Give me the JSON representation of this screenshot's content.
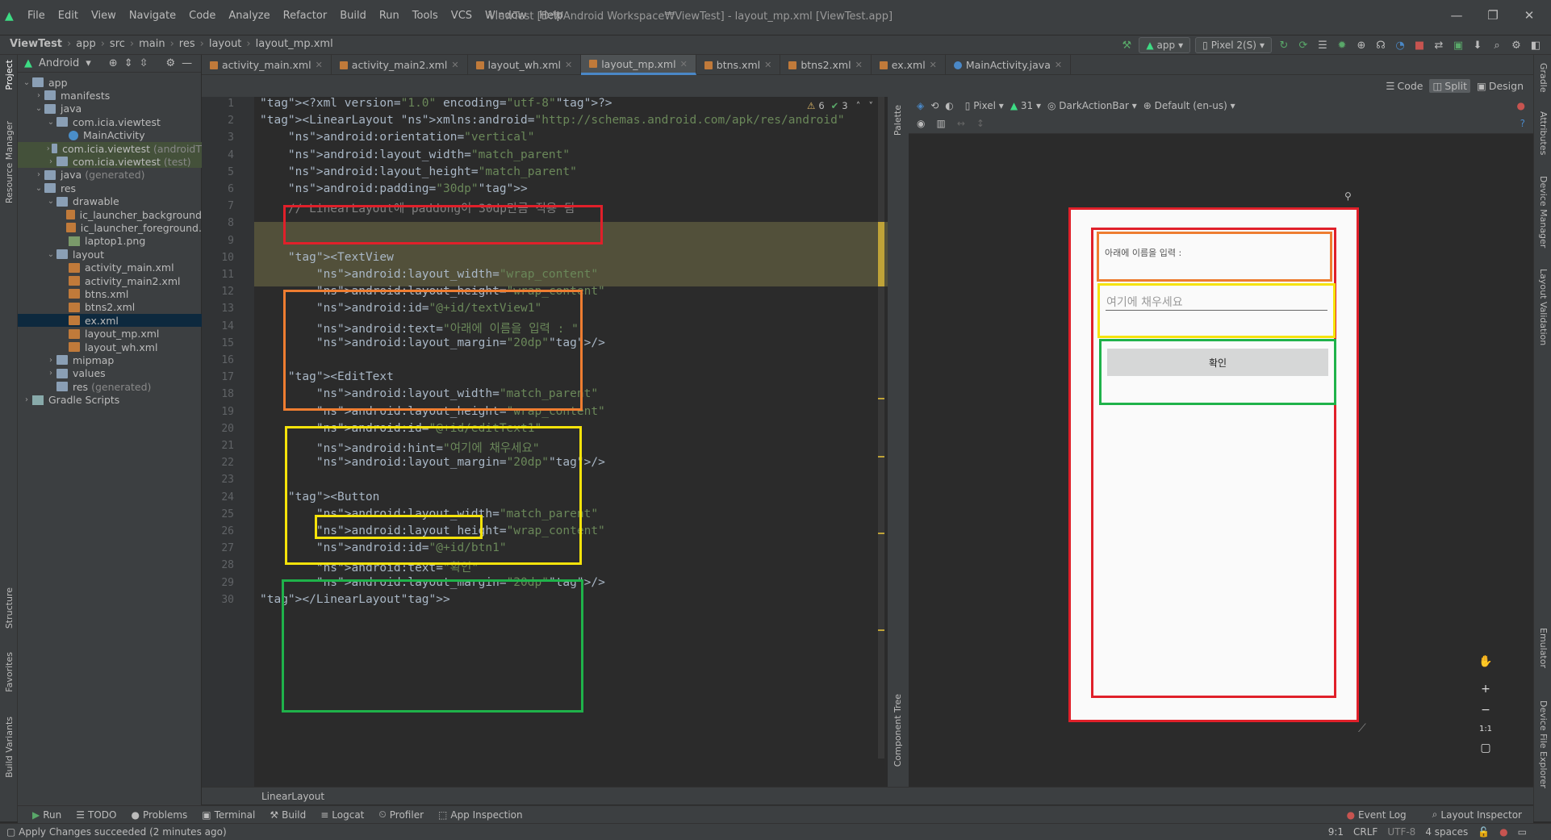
{
  "menubar": {
    "items": [
      "File",
      "Edit",
      "View",
      "Navigate",
      "Code",
      "Analyze",
      "Refactor",
      "Build",
      "Run",
      "Tools",
      "VCS",
      "Window",
      "Help"
    ],
    "window_title": "ViewTest [D:₩Android Workspace₩ViewTest] - layout_mp.xml [ViewTest.app]"
  },
  "breadcrumb": [
    "ViewTest",
    "app",
    "src",
    "main",
    "res",
    "layout",
    "layout_mp.xml"
  ],
  "toolbar": {
    "run_config": "app",
    "device": "Pixel 2(S)"
  },
  "project": {
    "view_label": "Android",
    "tree": [
      {
        "label": "app",
        "indent": 0,
        "kind": "folder",
        "arrow": "v"
      },
      {
        "label": "manifests",
        "indent": 1,
        "kind": "folder",
        "arrow": ">"
      },
      {
        "label": "java",
        "indent": 1,
        "kind": "folder",
        "arrow": "v"
      },
      {
        "label": "com.icia.viewtest",
        "indent": 2,
        "kind": "folder",
        "arrow": "v"
      },
      {
        "label": "MainActivity",
        "indent": 3,
        "kind": "class",
        "arrow": ""
      },
      {
        "label": "com.icia.viewtest",
        "suffix": "(androidT",
        "indent": 2,
        "kind": "folder",
        "arrow": ">",
        "hl": true
      },
      {
        "label": "com.icia.viewtest",
        "suffix": "(test)",
        "indent": 2,
        "kind": "folder",
        "arrow": ">",
        "hl": true
      },
      {
        "label": "java",
        "suffix": "(generated)",
        "indent": 1,
        "kind": "folder",
        "arrow": ">"
      },
      {
        "label": "res",
        "indent": 1,
        "kind": "folder",
        "arrow": "v"
      },
      {
        "label": "drawable",
        "indent": 2,
        "kind": "folder",
        "arrow": "v"
      },
      {
        "label": "ic_launcher_background",
        "indent": 3,
        "kind": "xml",
        "arrow": ""
      },
      {
        "label": "ic_launcher_foreground.",
        "indent": 3,
        "kind": "xml",
        "arrow": ""
      },
      {
        "label": "laptop1.png",
        "indent": 3,
        "kind": "png",
        "arrow": ""
      },
      {
        "label": "layout",
        "indent": 2,
        "kind": "folder",
        "arrow": "v"
      },
      {
        "label": "activity_main.xml",
        "indent": 3,
        "kind": "xml",
        "arrow": ""
      },
      {
        "label": "activity_main2.xml",
        "indent": 3,
        "kind": "xml",
        "arrow": ""
      },
      {
        "label": "btns.xml",
        "indent": 3,
        "kind": "xml",
        "arrow": ""
      },
      {
        "label": "btns2.xml",
        "indent": 3,
        "kind": "xml",
        "arrow": ""
      },
      {
        "label": "ex.xml",
        "indent": 3,
        "kind": "xml",
        "arrow": "",
        "sel": true
      },
      {
        "label": "layout_mp.xml",
        "indent": 3,
        "kind": "xml",
        "arrow": ""
      },
      {
        "label": "layout_wh.xml",
        "indent": 3,
        "kind": "xml",
        "arrow": ""
      },
      {
        "label": "mipmap",
        "indent": 2,
        "kind": "folder",
        "arrow": ">"
      },
      {
        "label": "values",
        "indent": 2,
        "kind": "folder",
        "arrow": ">"
      },
      {
        "label": "res",
        "suffix": "(generated)",
        "indent": 2,
        "kind": "folder",
        "arrow": ""
      },
      {
        "label": "Gradle Scripts",
        "indent": 0,
        "kind": "gradle",
        "arrow": ">"
      }
    ]
  },
  "tabs": [
    "activity_main.xml",
    "activity_main2.xml",
    "layout_wh.xml",
    "layout_mp.xml",
    "btns.xml",
    "btns2.xml",
    "ex.xml",
    "MainActivity.java"
  ],
  "active_tab": "layout_mp.xml",
  "editor_modes": {
    "code": "Code",
    "split": "Split",
    "design": "Design"
  },
  "inspections": {
    "warnings": "6",
    "ok": "3"
  },
  "code_lines": [
    "<?xml version=\"1.0\" encoding=\"utf-8\"?>",
    "<LinearLayout xmlns:android=\"http://schemas.android.com/apk/res/android\"",
    "    android:orientation=\"vertical\"",
    "    android:layout_width=\"match_parent\"",
    "    android:layout_height=\"match_parent\"",
    "    android:padding=\"30dp\">",
    "    // LinearLayout에 paddong이 30dp만큼 적용 됨",
    "",
    "",
    "    <TextView",
    "        android:layout_width=\"wrap_content\"",
    "        android:layout_height=\"wrap_content\"",
    "        android:id=\"@+id/textView1\"",
    "        android:text=\"아래에 이름을 입력 : \"",
    "        android:layout_margin=\"20dp\"/>",
    "",
    "    <EditText",
    "        android:layout_width=\"match_parent\"",
    "        android:layout_height=\"wrap_content\"",
    "        android:id=\"@+id/editText1\"",
    "        android:hint=\"여기에 채우세요\"",
    "        android:layout_margin=\"20dp\"/>",
    "",
    "    <Button",
    "        android:layout_width=\"match_parent\"",
    "        android:layout_height=\"wrap_content\"",
    "        android:id=\"@+id/btn1\"",
    "        android:text=\"확인\"",
    "        android:layout_margin=\"20dp\"/>",
    "</LinearLayout>"
  ],
  "design_toolbar": {
    "device": "Pixel",
    "api": "31",
    "theme": "DarkActionBar",
    "locale": "Default (en-us)"
  },
  "preview": {
    "textview": "아래에 이름을 입력 :",
    "edittext_hint": "여기에 채우세요",
    "button": "확인",
    "zoom_label": "1:1"
  },
  "side_panels": {
    "palette": "Palette",
    "component_tree": "Component Tree",
    "project": "Project",
    "resource_manager": "Resource Manager",
    "structure": "Structure",
    "favorites": "Favorites",
    "build_variants": "Build Variants",
    "gradle": "Gradle",
    "attributes": "Attributes",
    "device_manager": "Device Manager",
    "layout_validation": "Layout Validation",
    "emulator": "Emulator",
    "device_file_explorer": "Device File Explorer"
  },
  "editor_breadcrumb": "LinearLayout",
  "bottom_tabs": [
    "Run",
    "TODO",
    "Problems",
    "Terminal",
    "Build",
    "Logcat",
    "Profiler",
    "App Inspection"
  ],
  "bottom_right": [
    "Event Log",
    "Layout Inspector"
  ],
  "status": {
    "message": "Apply Changes succeeded (2 minutes ago)",
    "position": "9:1",
    "line_sep": "CRLF",
    "encoding": "UTF-8",
    "indent": "4 spaces"
  },
  "colors": {
    "red_box": "#e0202a",
    "orange_box": "#ee7d31",
    "yellow_box": "#f5e30a",
    "green_box": "#1fb24a",
    "accent": "#4a88c7"
  }
}
